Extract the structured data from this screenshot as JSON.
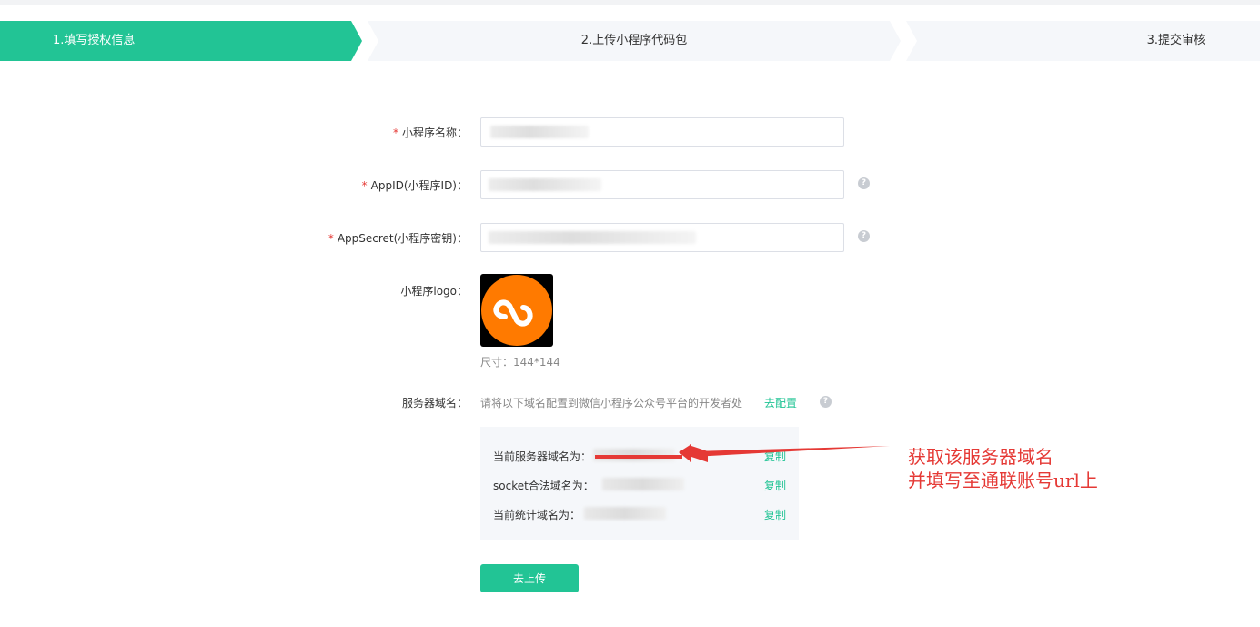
{
  "steps": [
    {
      "label": "1.填写授权信息",
      "active": true
    },
    {
      "label": "2.上传小程序代码包",
      "active": false
    },
    {
      "label": "3.提交审核",
      "active": false
    }
  ],
  "form": {
    "name_label": "小程序名称：",
    "appid_label": "AppID(小程序ID)：",
    "secret_label": "AppSecret(小程序密钥)：",
    "logo_label": "小程序logo：",
    "logo_size_note": "尺寸：144*144",
    "domain_label": "服务器域名：",
    "domain_desc": "请将以下域名配置到微信小程序公众号平台的开发者处",
    "go_config": "去配置",
    "required_mark": "*",
    "help_mark": "?"
  },
  "domains": {
    "server_label": "当前服务器域名为：",
    "socket_label": "socket合法域名为：",
    "stats_label": "当前统计域名为：",
    "copy_label": "复制"
  },
  "actions": {
    "upload_label": "去上传"
  },
  "annotation": {
    "line1": "获取该服务器域名",
    "line2": "并填写至通联账号url上"
  },
  "colors": {
    "primary": "#22c495",
    "required": "#e53935",
    "annotation": "#e53935",
    "logo_bg": "#ff7a00"
  },
  "icons": {
    "logo": "mini-program-logo-icon",
    "help": "question-mark-icon",
    "arrow": "red-arrow-icon"
  }
}
